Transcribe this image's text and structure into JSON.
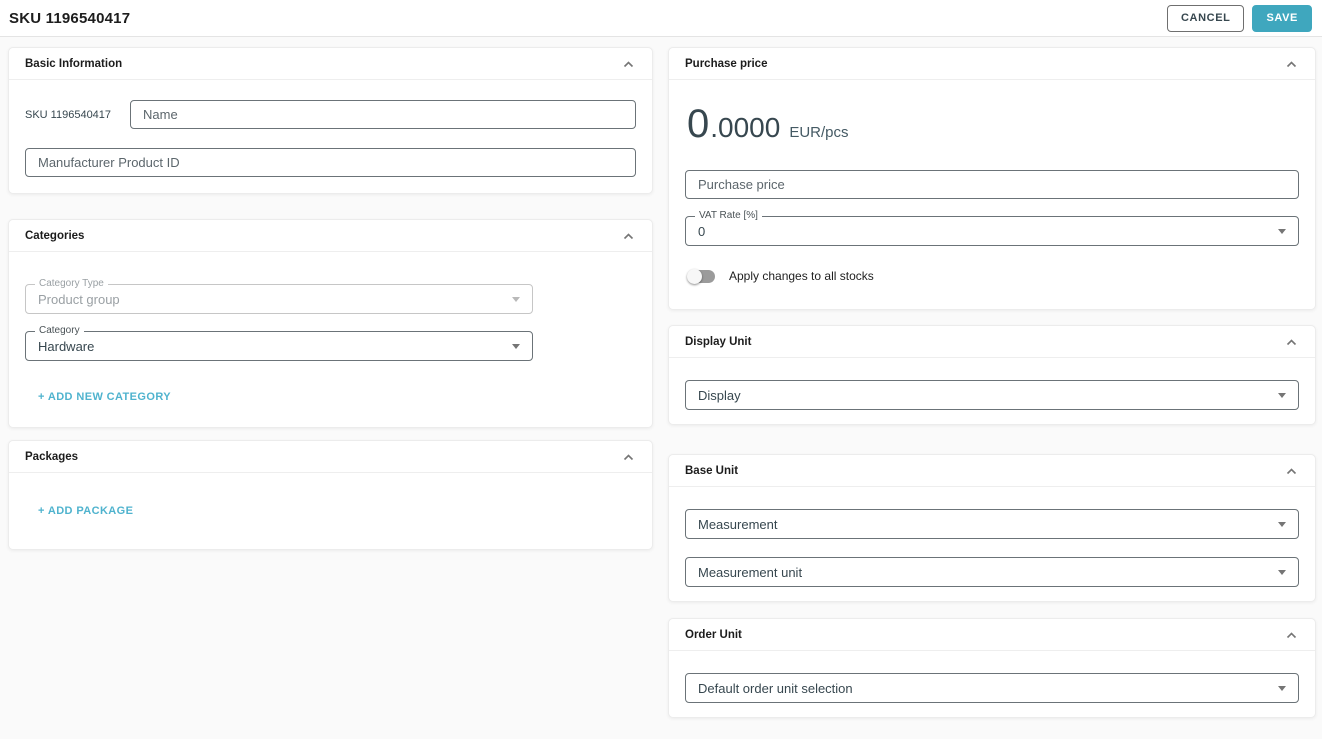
{
  "header": {
    "title": "SKU 1196540417",
    "cancel_label": "CANCEL",
    "save_label": "SAVE"
  },
  "colors": {
    "accent_button": "#3fa7be",
    "link": "#4fb3ce",
    "price_text": "#37474f"
  },
  "basic_information": {
    "title": "Basic Information",
    "sku_label": "SKU 1196540417",
    "name_placeholder": "Name",
    "manufacturer_placeholder": "Manufacturer Product ID"
  },
  "categories": {
    "title": "Categories",
    "category_type": {
      "label": "Category Type",
      "value": "Product group"
    },
    "category": {
      "label": "Category",
      "value": "Hardware"
    },
    "add_link": "+ ADD NEW CATEGORY"
  },
  "packages": {
    "title": "Packages",
    "add_link": "+ ADD PACKAGE"
  },
  "purchase_price": {
    "title": "Purchase price",
    "amount_int": "0",
    "amount_dec": ".0000",
    "unit": "EUR/pcs",
    "input_placeholder": "Purchase price",
    "vat": {
      "label": "VAT Rate [%]",
      "value": "0"
    },
    "toggle_label": "Apply changes to all stocks"
  },
  "display_unit": {
    "title": "Display Unit",
    "select_value": "Display"
  },
  "base_unit": {
    "title": "Base Unit",
    "measurement_value": "Measurement",
    "measurement_unit_value": "Measurement unit"
  },
  "order_unit": {
    "title": "Order Unit",
    "select_value": "Default order unit selection"
  }
}
